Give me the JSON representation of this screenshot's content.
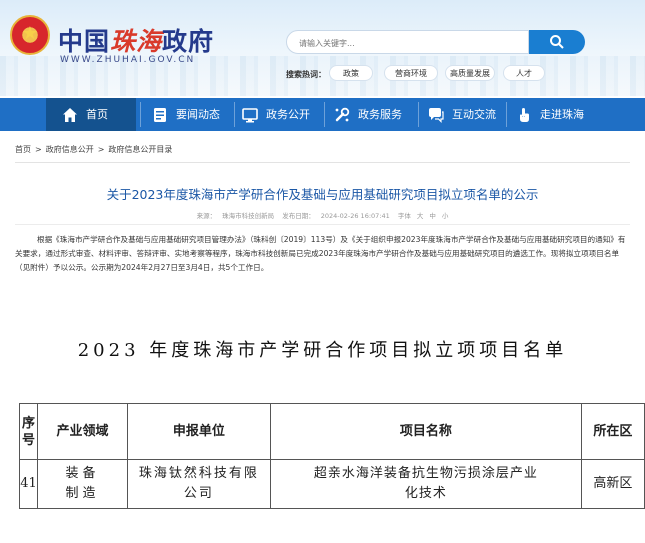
{
  "header": {
    "site_title_a": "中国",
    "site_title_b": "珠海",
    "site_title_c": "政府",
    "site_url": "WWW.ZHUHAI.GOV.CN",
    "search_placeholder": "请输入关键字...",
    "hot_label": "搜索热词：",
    "hot_words": [
      "政策",
      "营商环境",
      "高质量发展",
      "人才"
    ]
  },
  "nav": {
    "items": [
      {
        "label": "首页",
        "icon": "home-icon"
      },
      {
        "label": "要闻动态",
        "icon": "news-icon"
      },
      {
        "label": "政务公开",
        "icon": "open-government-icon"
      },
      {
        "label": "政务服务",
        "icon": "service-icon"
      },
      {
        "label": "互动交流",
        "icon": "chat-icon"
      },
      {
        "label": "走进珠海",
        "icon": "touch-icon"
      }
    ],
    "active_color": "#14528f",
    "bar_color": "#1f6fc5"
  },
  "breadcrumb": [
    "首页",
    ">",
    "政府信息公开",
    ">",
    "政府信息公开目录"
  ],
  "article": {
    "title": "关于2023年度珠海市产学研合作及基础与应用基础研究项目拟立项名单的公示",
    "meta_source_label": "来源：",
    "meta_source": "珠海市科技创新局",
    "meta_date_label": "发布日期：",
    "meta_date": "2024-02-26 16:07:41",
    "meta_font_label": "字体",
    "meta_font_large": "大",
    "meta_font_medium": "中",
    "meta_font_small": "小",
    "body": "根据《珠海市产学研合作及基础与应用基础研究项目管理办法》（珠科创〔2019〕113号）及《关于组织申报2023年度珠海市产学研合作及基础与应用基础研究项目的通知》有关要求，通过形式审查、材料评审、答辩评审、实地考察等程序，珠海市科技创新局已完成2023年度珠海市产学研合作及基础与应用基础研究项目的遴选工作。现将拟立项项目名单（见附件）予以公示。公示期为2024年2月27日至3月4日，共5个工作日。"
  },
  "attachment": {
    "title": "2023 年度珠海市产学研合作项目拟立项项目名单",
    "columns": [
      "序号",
      "产业领域",
      "申报单位",
      "项目名称",
      "所在区"
    ],
    "rows": [
      [
        "41",
        "装备制造",
        "珠海钛然科技有限公司",
        "超亲水海洋装备抗生物污损涂层产业化技术",
        "高新区"
      ]
    ]
  }
}
